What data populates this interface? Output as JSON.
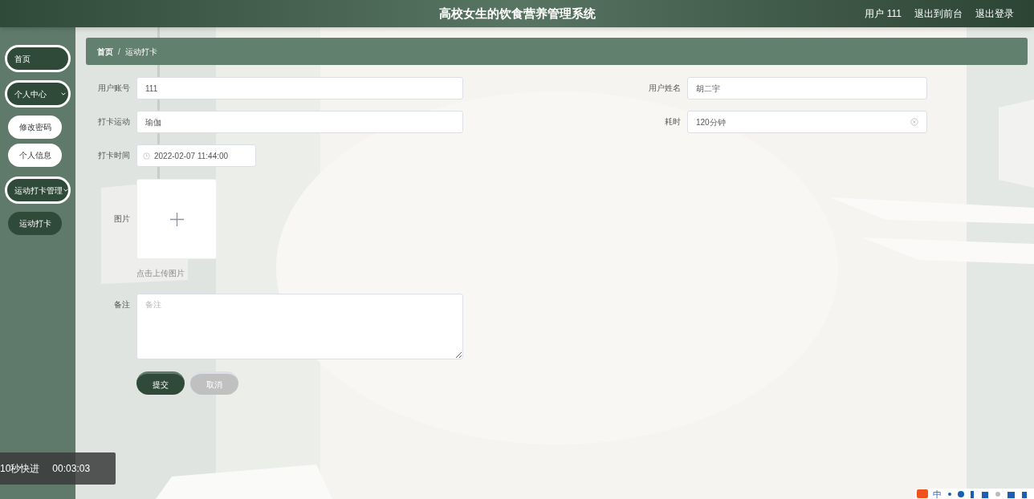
{
  "header": {
    "title": "高校女生的饮食营养管理系统",
    "links": [
      {
        "label": "用户 111"
      },
      {
        "label": "退出到前台"
      },
      {
        "label": "退出登录"
      }
    ]
  },
  "sidebar": {
    "items": [
      {
        "label": "首页",
        "selected": false
      },
      {
        "label": "个人中心",
        "selected": false,
        "children": [
          {
            "label": "修改密码",
            "selected": false
          },
          {
            "label": "个人信息",
            "selected": false
          }
        ]
      },
      {
        "label": "运动打卡管理",
        "selected": false,
        "children": [
          {
            "label": "运动打卡",
            "selected": true
          }
        ]
      }
    ]
  },
  "breadcrumb": {
    "separator": "/",
    "items": [
      "首页",
      "运动打卡"
    ]
  },
  "form": {
    "rows": [
      [
        {
          "kind": "text",
          "label": "用户账号",
          "value": "111"
        },
        {
          "kind": "text",
          "label": "用户姓名",
          "value": "胡二宇"
        }
      ],
      [
        {
          "kind": "text",
          "label": "打卡运动",
          "value": "瑜伽"
        },
        {
          "kind": "text",
          "label": "耗时",
          "value": "120分钟",
          "clearable": true
        }
      ],
      [
        {
          "kind": "datetime",
          "label": "打卡时间",
          "value": "2022-02-07 11:44:00"
        }
      ],
      [
        {
          "kind": "upload",
          "label": "图片",
          "hint": "点击上传图片"
        }
      ],
      [
        {
          "kind": "textarea",
          "label": "备注",
          "placeholder": "备注"
        }
      ]
    ],
    "buttons": [
      {
        "kind": "primary",
        "label": "提交"
      },
      {
        "kind": "secondary",
        "label": "取消"
      }
    ]
  },
  "player_overlay": {
    "action": "10秒快进",
    "time": "00:03:03"
  },
  "ime_bar": {
    "mode": "中"
  }
}
